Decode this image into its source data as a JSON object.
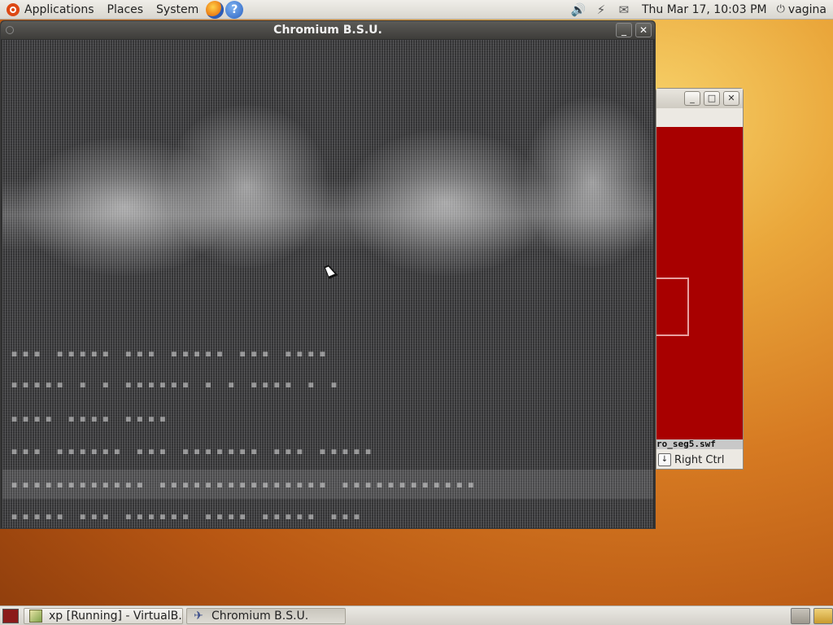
{
  "top_panel": {
    "menus": [
      "Applications",
      "Places",
      "System"
    ],
    "help_glyph": "?",
    "clock": "Thu Mar 17, 10:03 PM",
    "user": "vagina",
    "tray_icons": [
      "volume-icon",
      "network-icon",
      "mail-icon"
    ]
  },
  "chromium_window": {
    "title": "Chromium B.S.U.",
    "minimize": "_",
    "close": "✕"
  },
  "vbox_window": {
    "minimize": "_",
    "maximize": "□",
    "close": "✕",
    "flash_file": "ro_seg5.swf",
    "host_key": "Right Ctrl",
    "screen_color": "#a80000"
  },
  "taskbar": {
    "tasks": [
      {
        "label": "xp [Running] - VirtualB...",
        "icon": "virtualbox-icon",
        "active": false
      },
      {
        "label": "Chromium B.S.U.",
        "icon": "jet-icon",
        "active": true
      }
    ]
  },
  "game_glitch": {
    "rows": [
      "▪▪▪  ▪▪▪▪▪        ▪▪▪  ▪▪▪▪▪        ▪▪▪  ▪▪▪▪",
      "▪▪▪▪▪  ▪     ▪    ▪▪▪▪▪▪  ▪     ▪   ▪▪▪▪  ▪   ▪",
      "▪▪▪▪              ▪▪▪▪              ▪▪▪▪",
      "▪▪▪  ▪▪▪▪▪▪       ▪▪▪  ▪▪▪▪▪▪▪      ▪▪▪   ▪▪▪▪▪",
      "▪▪▪▪▪▪▪▪▪▪▪▪      ▪▪▪▪▪▪▪▪▪▪▪▪▪▪▪   ▪▪▪▪▪▪▪▪▪▪▪▪",
      "▪▪▪▪▪  ▪▪▪        ▪▪▪▪▪▪  ▪▪▪▪      ▪▪▪▪▪  ▪▪▪"
    ]
  }
}
